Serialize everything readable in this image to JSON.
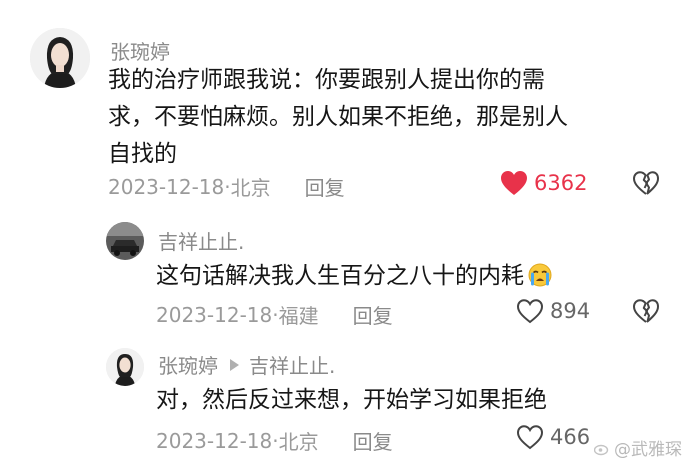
{
  "comments": [
    {
      "user": "张琬婷",
      "lines": [
        "我的治疗师跟我说：你要跟别人提出你的需",
        "求，不要怕麻烦。别人如果不拒绝，那是别人",
        "自找的"
      ],
      "date": "2023-12-18",
      "location": "北京",
      "reply_label": "回复",
      "likes": "6362",
      "liked": true
    },
    {
      "user": "吉祥止止.",
      "lines": [
        "这句话解决我人生百分之八十的内耗"
      ],
      "emoji": "crying-face",
      "date": "2023-12-18",
      "location": "福建",
      "reply_label": "回复",
      "likes": "894",
      "liked": false
    },
    {
      "user": "张琬婷",
      "reply_to": "吉祥止止.",
      "lines": [
        "对，然后反过来想，开始学习如果拒绝"
      ],
      "date": "2023-12-18",
      "location": "北京",
      "reply_label": "回复",
      "likes": "466",
      "liked": false
    }
  ],
  "separator": "·",
  "watermark": "@武雅琛",
  "colors": {
    "like_active": "#e8324a",
    "meta": "#9a9a9a",
    "username": "#8a8a8a"
  }
}
